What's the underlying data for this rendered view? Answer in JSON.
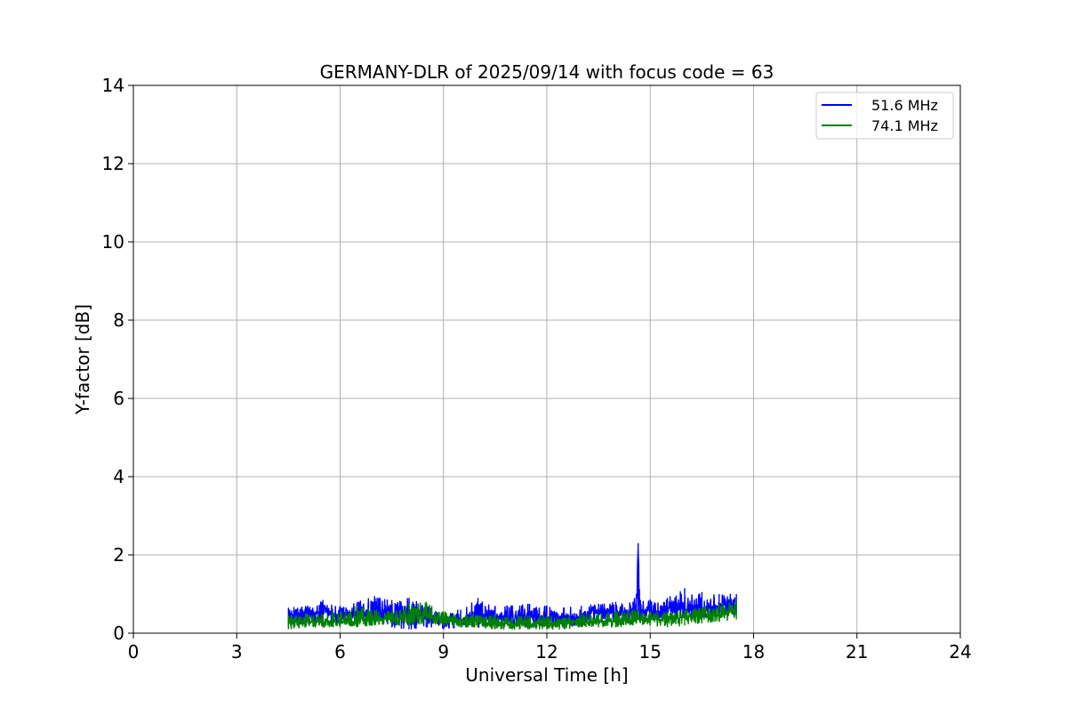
{
  "chart_data": {
    "type": "line",
    "title": "GERMANY-DLR of 2025/09/14 with focus code = 63",
    "xlabel": "Universal Time [h]",
    "ylabel": "Y-factor [dB]",
    "xlim": [
      0,
      24
    ],
    "ylim": [
      0,
      14
    ],
    "xticks": [
      0,
      3,
      6,
      9,
      12,
      15,
      18,
      21,
      24
    ],
    "yticks": [
      0,
      2,
      4,
      6,
      8,
      10,
      12,
      14
    ],
    "grid": true,
    "legend_position": "top-right",
    "series": [
      {
        "name": "51.6 MHz",
        "color": "#0000ff",
        "x": [
          4.5,
          5.0,
          5.5,
          6.0,
          6.5,
          7.0,
          7.5,
          8.0,
          8.5,
          9.0,
          9.5,
          10.0,
          10.5,
          11.0,
          11.5,
          12.0,
          12.5,
          13.0,
          13.5,
          14.0,
          14.5,
          14.6,
          14.65,
          14.7,
          15.0,
          15.5,
          16.0,
          16.5,
          17.0,
          17.5
        ],
        "y": [
          0.45,
          0.5,
          0.55,
          0.45,
          0.45,
          0.5,
          0.5,
          0.5,
          0.45,
          0.35,
          0.35,
          0.4,
          0.4,
          0.4,
          0.4,
          0.4,
          0.4,
          0.45,
          0.5,
          0.55,
          0.55,
          0.7,
          2.25,
          0.6,
          0.55,
          0.6,
          0.65,
          0.65,
          0.7,
          0.75
        ],
        "y_min": [
          0.15,
          0.2,
          0.2,
          0.2,
          0.2,
          0.25,
          0.15,
          0.1,
          0.15,
          0.1,
          0.15,
          0.15,
          0.15,
          0.15,
          0.15,
          0.15,
          0.15,
          0.2,
          0.25,
          0.3,
          0.3,
          0.3,
          0.35,
          0.3,
          0.35,
          0.35,
          0.4,
          0.4,
          0.45,
          0.5
        ],
        "y_max": [
          0.65,
          0.7,
          0.85,
          0.7,
          0.8,
          0.95,
          0.85,
          0.9,
          0.7,
          0.55,
          0.6,
          0.9,
          0.7,
          0.7,
          0.75,
          0.7,
          0.65,
          0.7,
          0.75,
          0.8,
          0.8,
          1.0,
          2.3,
          0.85,
          0.85,
          0.9,
          1.15,
          1.05,
          1.0,
          1.0
        ]
      },
      {
        "name": "74.1 MHz",
        "color": "#008000",
        "x": [
          4.5,
          5.0,
          5.5,
          6.0,
          6.5,
          7.0,
          7.5,
          8.0,
          8.5,
          9.0,
          9.5,
          10.0,
          10.5,
          11.0,
          11.5,
          12.0,
          12.5,
          13.0,
          13.5,
          14.0,
          14.5,
          15.0,
          15.5,
          16.0,
          16.5,
          17.0,
          17.5
        ],
        "y": [
          0.3,
          0.3,
          0.3,
          0.3,
          0.35,
          0.4,
          0.35,
          0.4,
          0.45,
          0.35,
          0.3,
          0.3,
          0.25,
          0.25,
          0.25,
          0.25,
          0.25,
          0.3,
          0.3,
          0.3,
          0.35,
          0.35,
          0.35,
          0.4,
          0.45,
          0.5,
          0.55
        ],
        "y_min": [
          0.1,
          0.15,
          0.15,
          0.15,
          0.15,
          0.2,
          0.2,
          0.2,
          0.25,
          0.2,
          0.15,
          0.15,
          0.1,
          0.1,
          0.1,
          0.1,
          0.1,
          0.15,
          0.15,
          0.15,
          0.2,
          0.2,
          0.15,
          0.2,
          0.25,
          0.3,
          0.35
        ],
        "y_max": [
          0.45,
          0.5,
          0.5,
          0.55,
          0.7,
          0.6,
          0.55,
          0.75,
          0.8,
          0.55,
          0.5,
          0.45,
          0.45,
          0.4,
          0.45,
          0.45,
          0.4,
          0.5,
          0.5,
          0.55,
          0.6,
          0.55,
          0.55,
          0.6,
          0.65,
          0.75,
          0.8
        ]
      }
    ]
  }
}
